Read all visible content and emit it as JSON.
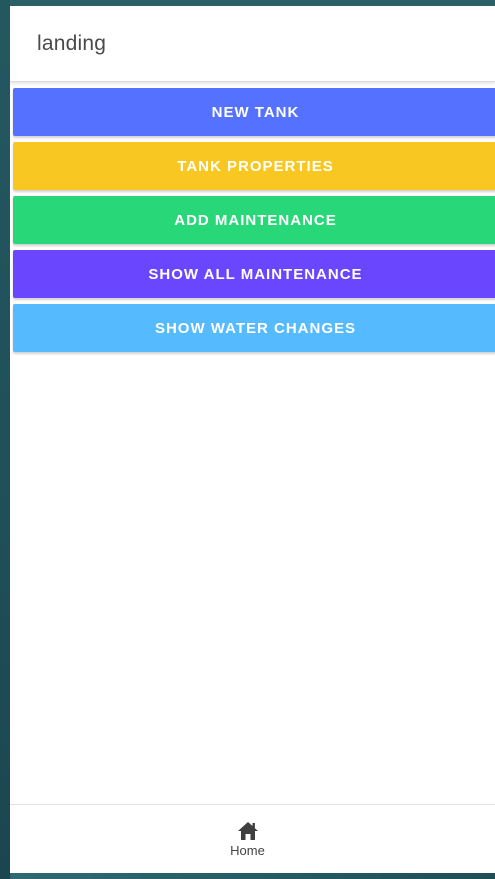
{
  "header": {
    "title": "landing"
  },
  "menu": {
    "items": [
      {
        "label": "NEW TANK",
        "color": "#5571ff"
      },
      {
        "label": "TANK PROPERTIES",
        "color": "#f8c722"
      },
      {
        "label": "ADD MAINTENANCE",
        "color": "#28d878"
      },
      {
        "label": "SHOW ALL MAINTENANCE",
        "color": "#6a47ff"
      },
      {
        "label": "SHOW WATER CHANGES",
        "color": "#56baff"
      }
    ]
  },
  "footer": {
    "tabs": [
      {
        "label": "Home",
        "icon": "home-icon"
      }
    ]
  }
}
